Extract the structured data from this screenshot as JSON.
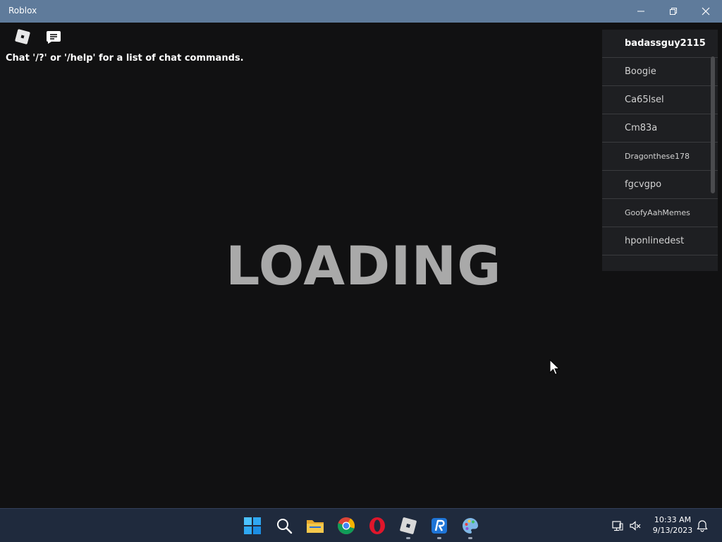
{
  "window": {
    "title": "Roblox"
  },
  "game": {
    "chat_hint": "Chat '/?' or '/help' for a list of chat commands.",
    "loading_text": "LOADING"
  },
  "player_list": [
    {
      "name": "badassguy2115"
    },
    {
      "name": "Boogie"
    },
    {
      "name": "Ca65lsel"
    },
    {
      "name": "Cm83a"
    },
    {
      "name": "Dragonthese178"
    },
    {
      "name": "fgcvgpo"
    },
    {
      "name": "GoofyAahMemes"
    },
    {
      "name": "hponlinedest"
    }
  ],
  "taskbar": {
    "apps": [
      "start-icon",
      "search-icon",
      "file-explorer-icon",
      "chrome-icon",
      "opera-icon",
      "roblox-icon",
      "roblox-studio-icon",
      "paint-icon"
    ],
    "clock_time": "10:33 AM",
    "clock_date": "9/13/2023"
  },
  "colors": {
    "titlebar": "#5f7b9b",
    "background": "#111112",
    "taskbar": "#1f2a3d",
    "loading_text": "#a9a9a9"
  }
}
